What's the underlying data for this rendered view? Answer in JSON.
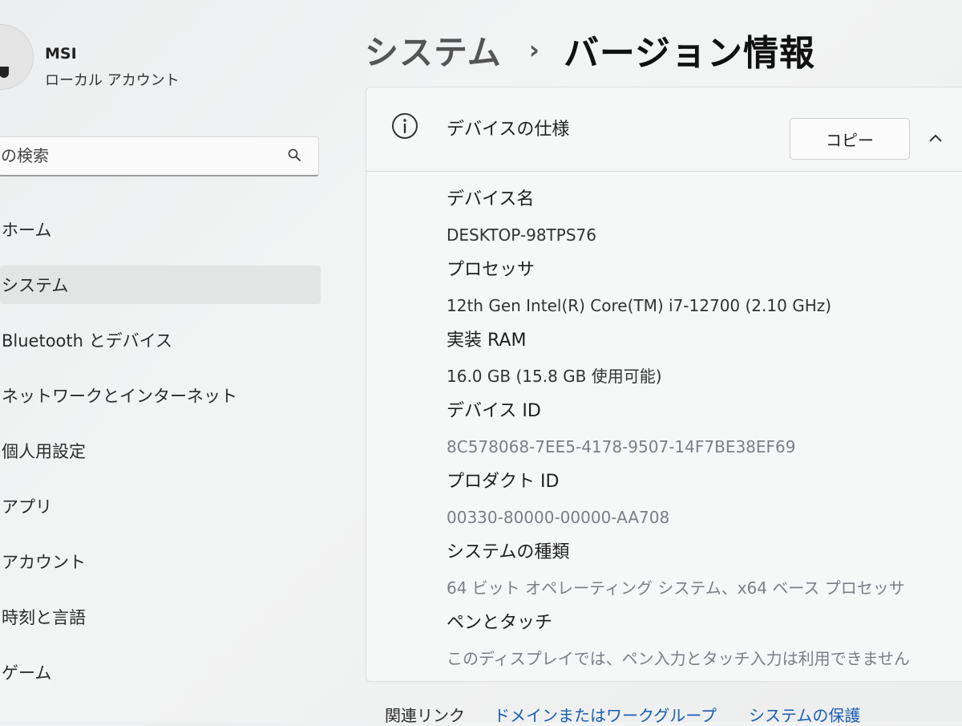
{
  "account": {
    "name": "MSI",
    "type": "ローカル アカウント"
  },
  "search": {
    "placeholder": "の検索"
  },
  "nav": {
    "items": [
      {
        "label": "ホーム"
      },
      {
        "label": "システム",
        "active": true
      },
      {
        "label": "Bluetooth とデバイス"
      },
      {
        "label": "ネットワークとインターネット"
      },
      {
        "label": "個人用設定"
      },
      {
        "label": "アプリ"
      },
      {
        "label": "アカウント"
      },
      {
        "label": "時刻と言語"
      },
      {
        "label": "ゲーム"
      }
    ]
  },
  "breadcrumb": {
    "parent": "システム",
    "separator": "›",
    "current": "バージョン情報"
  },
  "device_specs": {
    "title": "デバイスの仕様",
    "copy_label": "コピー",
    "items": [
      {
        "label": "デバイス名",
        "value": "DESKTOP-98TPS76"
      },
      {
        "label": "プロセッサ",
        "value": "12th Gen Intel(R) Core(TM) i7-12700 (2.10 GHz)"
      },
      {
        "label": "実装 RAM",
        "value": "16.0 GB (15.8 GB 使用可能)"
      },
      {
        "label": "デバイス ID",
        "value": "8C578068-7EE5-4178-9507-14F7BE38EF69"
      },
      {
        "label": "プロダクト ID",
        "value": "00330-80000-00000-AA708"
      },
      {
        "label": "システムの種類",
        "value": "64 ビット オペレーティング システム、x64 ベース プロセッサ"
      },
      {
        "label": "ペンとタッチ",
        "value": "このディスプレイでは、ペン入力とタッチ入力は利用できません"
      }
    ]
  },
  "related": {
    "label": "関連リンク",
    "links": [
      "ドメインまたはワークグループ",
      "システムの保護"
    ]
  },
  "colors": {
    "accent": "#1a5fb4",
    "background": "#eceeef",
    "card": "#f6f7f7"
  }
}
